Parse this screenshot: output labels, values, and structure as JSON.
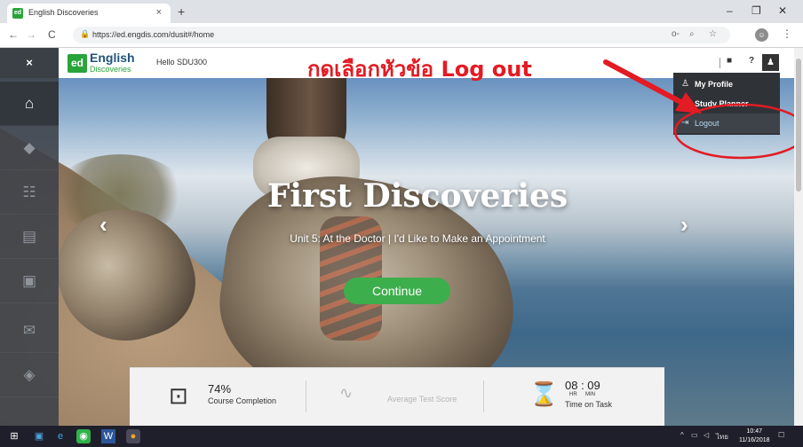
{
  "browser": {
    "tab_title": "English Discoveries",
    "favicon_text": "ed",
    "tab_close": "×",
    "new_tab": "+",
    "url": "https://ed.engdis.com/dusit#/home",
    "lock_icon": "🔒",
    "back": "←",
    "forward": "→",
    "reload": "C",
    "key_icon": "o-",
    "zoom_icon": "⌕",
    "star_icon": "☆",
    "menu_icon": "⋮",
    "minimize": "–",
    "restore": "❐",
    "close": "✕"
  },
  "sidebar": {
    "close_icon": "×",
    "items": [
      {
        "name": "home",
        "icon": "⌂"
      },
      {
        "name": "courses",
        "icon": "◆"
      },
      {
        "name": "community",
        "icon": "☷"
      },
      {
        "name": "assignments",
        "icon": "▤"
      },
      {
        "name": "tests",
        "icon": "▣"
      },
      {
        "name": "messages",
        "icon": "✉"
      },
      {
        "name": "library",
        "icon": "◈"
      }
    ]
  },
  "header": {
    "logo_ed": "ed",
    "logo_english": "English",
    "logo_discoveries": "Discoveries",
    "greeting": "Hello SDU300",
    "messages_icon": "■",
    "help_icon": "?",
    "user_icon": "♟"
  },
  "annotation": {
    "text": "กดเลือกหัวข้อ Log out",
    "color": "#e31b23"
  },
  "dropdown": {
    "items": [
      {
        "label": "My Profile",
        "icon": "♙"
      },
      {
        "label": "Study Planner",
        "icon": "☰"
      },
      {
        "label": "Logout",
        "icon": "⇥"
      }
    ]
  },
  "carousel": {
    "title": "First Discoveries",
    "subtitle": "Unit 5: At the Doctor | I'd Like to Make an Appointment",
    "continue_label": "Continue",
    "prev_icon": "‹",
    "next_icon": "›"
  },
  "stats": {
    "completion_value": "74%",
    "completion_label": "Course Completion",
    "test_score_label": "Average Test Score",
    "time_value": "08 : 09",
    "time_units_hr": "HR",
    "time_units_min": "MIN",
    "time_label": "Time on Task"
  },
  "taskbar": {
    "time": "10:47",
    "date": "11/16/2018",
    "lang": "ไทย",
    "tray_up": "^"
  },
  "colors": {
    "accent_green": "#3dae4c",
    "sidebar": "#3e424a",
    "dropdown": "#2f3338"
  }
}
